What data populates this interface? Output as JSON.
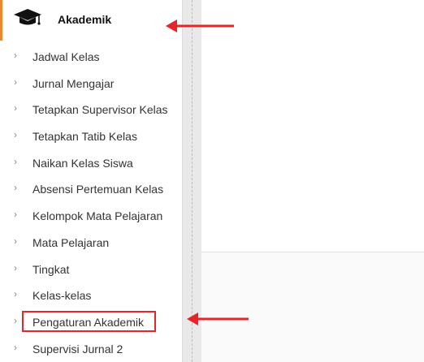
{
  "sidebar": {
    "section": {
      "title": "Akademik",
      "icon": "graduation-cap-icon"
    },
    "items": [
      {
        "label": "Jadwal Kelas"
      },
      {
        "label": "Jurnal Mengajar"
      },
      {
        "label": "Tetapkan Supervisor Kelas"
      },
      {
        "label": "Tetapkan Tatib Kelas"
      },
      {
        "label": "Naikan Kelas Siswa"
      },
      {
        "label": "Absensi Pertemuan Kelas"
      },
      {
        "label": "Kelompok Mata Pelajaran"
      },
      {
        "label": "Mata Pelajaran"
      },
      {
        "label": "Tingkat"
      },
      {
        "label": "Kelas-kelas"
      },
      {
        "label": "Pengaturan Akademik"
      },
      {
        "label": "Supervisi Jurnal 2"
      }
    ],
    "chevron": "›"
  },
  "colors": {
    "accent": "#f0862c",
    "annotation_red": "#e5252a"
  }
}
